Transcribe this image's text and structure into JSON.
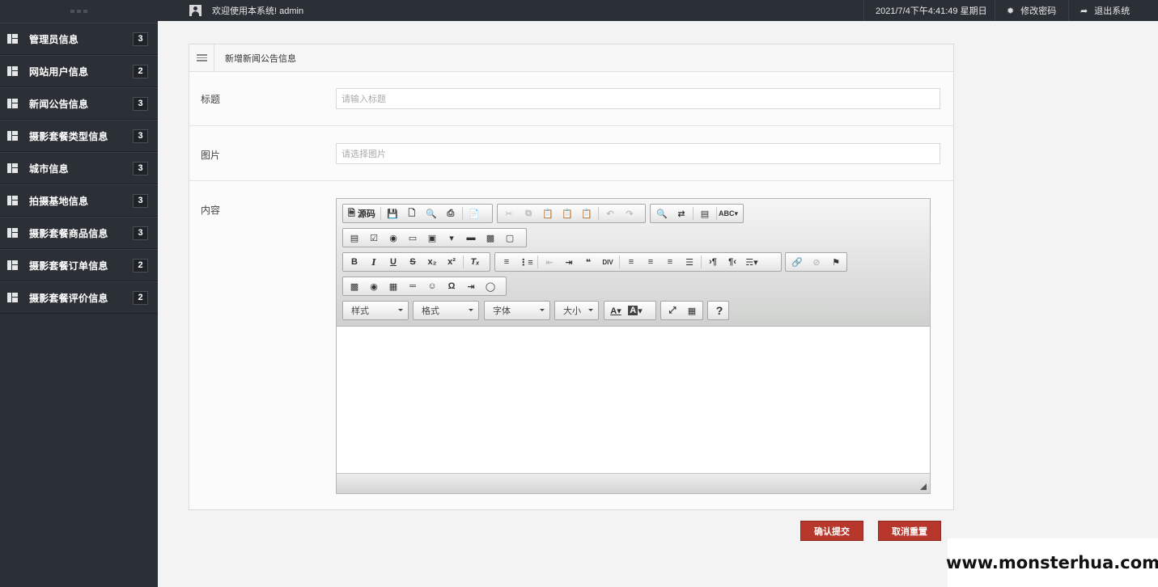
{
  "sidebar": {
    "items": [
      {
        "label": "管理员信息",
        "badge": "3"
      },
      {
        "label": "网站用户信息",
        "badge": "2"
      },
      {
        "label": "新闻公告信息",
        "badge": "3"
      },
      {
        "label": "摄影套餐类型信息",
        "badge": "3"
      },
      {
        "label": "城市信息",
        "badge": "3"
      },
      {
        "label": "拍摄基地信息",
        "badge": "3"
      },
      {
        "label": "摄影套餐商品信息",
        "badge": "3"
      },
      {
        "label": "摄影套餐订单信息",
        "badge": "2"
      },
      {
        "label": "摄影套餐评价信息",
        "badge": "2"
      }
    ]
  },
  "topbar": {
    "welcome": "欢迎使用本系统! admin",
    "datetime": "2021/7/4下午4:41:49 星期日",
    "change_password": "修改密码",
    "logout": "退出系统"
  },
  "panel": {
    "title": "新增新闻公告信息",
    "title_field": {
      "label": "标题",
      "placeholder": "请输入标题"
    },
    "image_field": {
      "label": "图片",
      "placeholder": "请选择图片"
    },
    "content_field": {
      "label": "内容"
    }
  },
  "editor": {
    "source_label": "源码",
    "combos": {
      "style": "样式",
      "format": "格式",
      "font": "字体",
      "size": "大小"
    }
  },
  "actions": {
    "submit": "确认提交",
    "reset": "取消重置"
  },
  "watermark": "www.monsterhua.com"
}
